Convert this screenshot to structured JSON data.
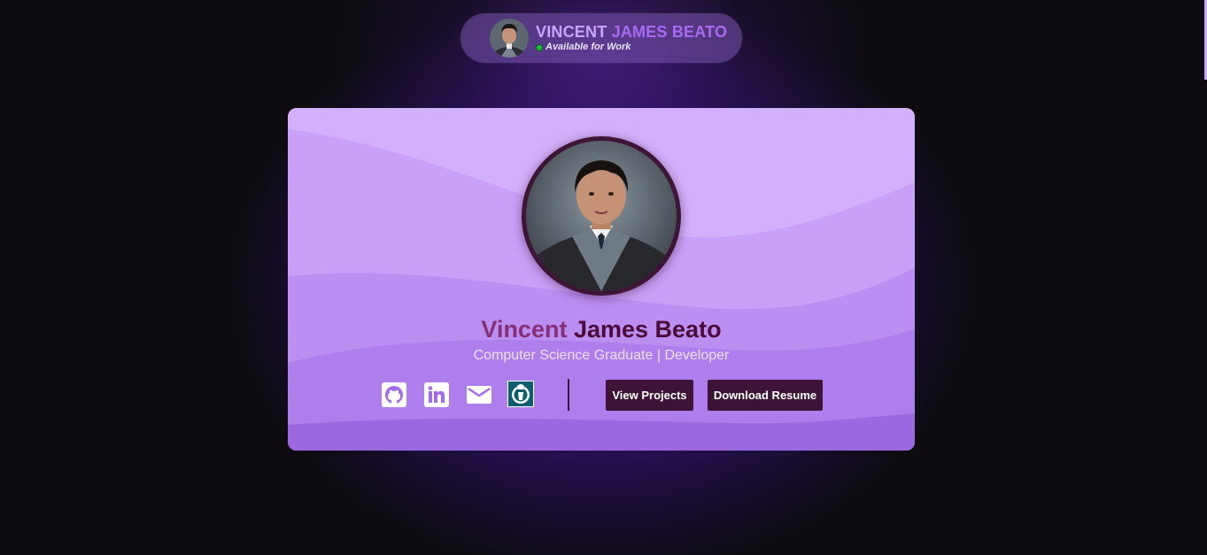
{
  "header": {
    "first_name": "VINCENT",
    "last_names": "JAMES BEATO",
    "status": "Available for Work",
    "status_color": "#19c13a"
  },
  "profile": {
    "first_name": "Vincent",
    "last_names": "James Beato",
    "tagline": "Computer Science Graduate | Developer"
  },
  "social": [
    {
      "name": "github",
      "icon": "github-icon"
    },
    {
      "name": "linkedin",
      "icon": "linkedin-icon"
    },
    {
      "name": "email",
      "icon": "mail-icon"
    },
    {
      "name": "codechef",
      "icon": "codechef-icon"
    }
  ],
  "actions": {
    "view_projects": "View Projects",
    "download_resume": "Download Resume"
  },
  "colors": {
    "accent": "#a66bf2",
    "button_bg": "#3d1438",
    "name_dark": "#4a0b38",
    "name_first": "#872f76",
    "card_top": "#d3b0fb",
    "card_bottom": "#9a64e0"
  }
}
